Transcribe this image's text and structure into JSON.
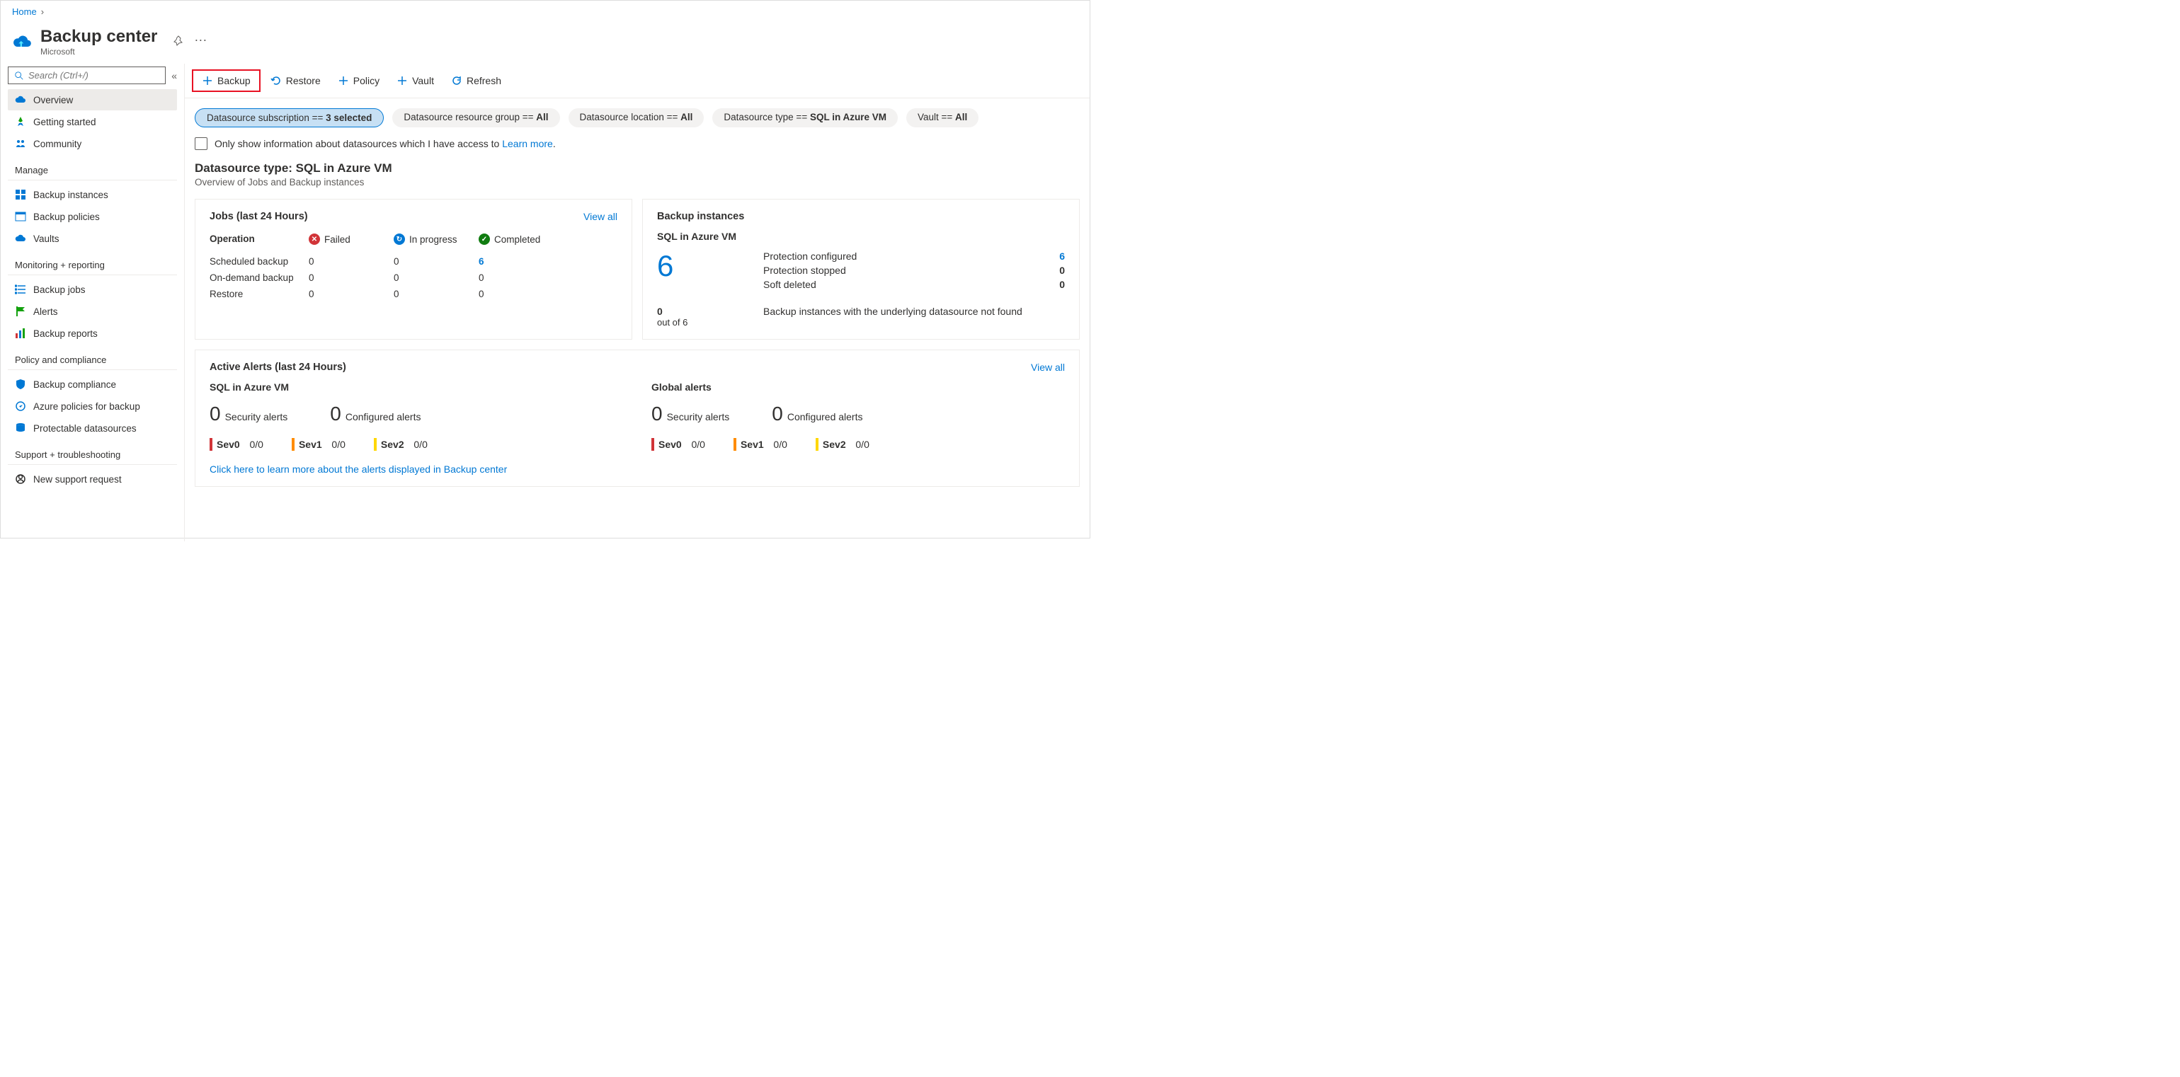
{
  "breadcrumb": {
    "home": "Home"
  },
  "header": {
    "title": "Backup center",
    "subtitle": "Microsoft"
  },
  "search": {
    "placeholder": "Search (Ctrl+/)"
  },
  "nav": {
    "overview": "Overview",
    "getting_started": "Getting started",
    "community": "Community",
    "sections": {
      "manage": "Manage",
      "monitoring": "Monitoring + reporting",
      "policy": "Policy and compliance",
      "support": "Support + troubleshooting"
    },
    "manage_items": {
      "backup_instances": "Backup instances",
      "backup_policies": "Backup policies",
      "vaults": "Vaults"
    },
    "mon_items": {
      "backup_jobs": "Backup jobs",
      "alerts": "Alerts",
      "backup_reports": "Backup reports"
    },
    "policy_items": {
      "backup_compliance": "Backup compliance",
      "azure_policies": "Azure policies for backup",
      "protectable": "Protectable datasources"
    },
    "support_items": {
      "new_request": "New support request"
    }
  },
  "toolbar": {
    "backup": "Backup",
    "restore": "Restore",
    "policy": "Policy",
    "vault": "Vault",
    "refresh": "Refresh"
  },
  "filters": {
    "subscription": {
      "label": "Datasource subscription == ",
      "value": "3 selected"
    },
    "resource_group": {
      "label": "Datasource resource group == ",
      "value": "All"
    },
    "location": {
      "label": "Datasource location == ",
      "value": "All"
    },
    "type": {
      "label": "Datasource type == ",
      "value": "SQL in Azure VM"
    },
    "vault": {
      "label": "Vault == ",
      "value": "All"
    }
  },
  "access_row": {
    "text": "Only show information about datasources which I have access to ",
    "link": "Learn more"
  },
  "ds": {
    "title": "Datasource type: SQL in Azure VM",
    "subtitle": "Overview of Jobs and Backup instances"
  },
  "jobs": {
    "title": "Jobs (last 24 Hours)",
    "view_all": "View all",
    "headers": {
      "operation": "Operation",
      "failed": "Failed",
      "in_progress": "In progress",
      "completed": "Completed"
    },
    "rows": [
      {
        "op": "Scheduled backup",
        "failed": "0",
        "in_progress": "0",
        "completed": "6",
        "completed_link": true
      },
      {
        "op": "On-demand backup",
        "failed": "0",
        "in_progress": "0",
        "completed": "0"
      },
      {
        "op": "Restore",
        "failed": "0",
        "in_progress": "0",
        "completed": "0"
      }
    ]
  },
  "instances": {
    "title": "Backup instances",
    "subtitle": "SQL in Azure VM",
    "big": "6",
    "stats": [
      {
        "label": "Protection configured",
        "value": "6",
        "link": true
      },
      {
        "label": "Protection stopped",
        "value": "0"
      },
      {
        "label": "Soft deleted",
        "value": "0"
      }
    ],
    "foot_num": "0",
    "foot_sub": "out of 6",
    "foot_text": "Backup instances with the underlying datasource not found"
  },
  "alerts": {
    "title": "Active Alerts (last 24 Hours)",
    "view_all": "View all",
    "cols": [
      {
        "heading": "SQL in Azure VM",
        "security": "0",
        "security_label": "Security alerts",
        "configured": "0",
        "configured_label": "Configured alerts",
        "sevs": [
          {
            "name": "Sev0",
            "val": "0/0"
          },
          {
            "name": "Sev1",
            "val": "0/0"
          },
          {
            "name": "Sev2",
            "val": "0/0"
          }
        ]
      },
      {
        "heading": "Global alerts",
        "security": "0",
        "security_label": "Security alerts",
        "configured": "0",
        "configured_label": "Configured alerts",
        "sevs": [
          {
            "name": "Sev0",
            "val": "0/0"
          },
          {
            "name": "Sev1",
            "val": "0/0"
          },
          {
            "name": "Sev2",
            "val": "0/0"
          }
        ]
      }
    ],
    "learn_link": "Click here to learn more about the alerts displayed in Backup center"
  }
}
